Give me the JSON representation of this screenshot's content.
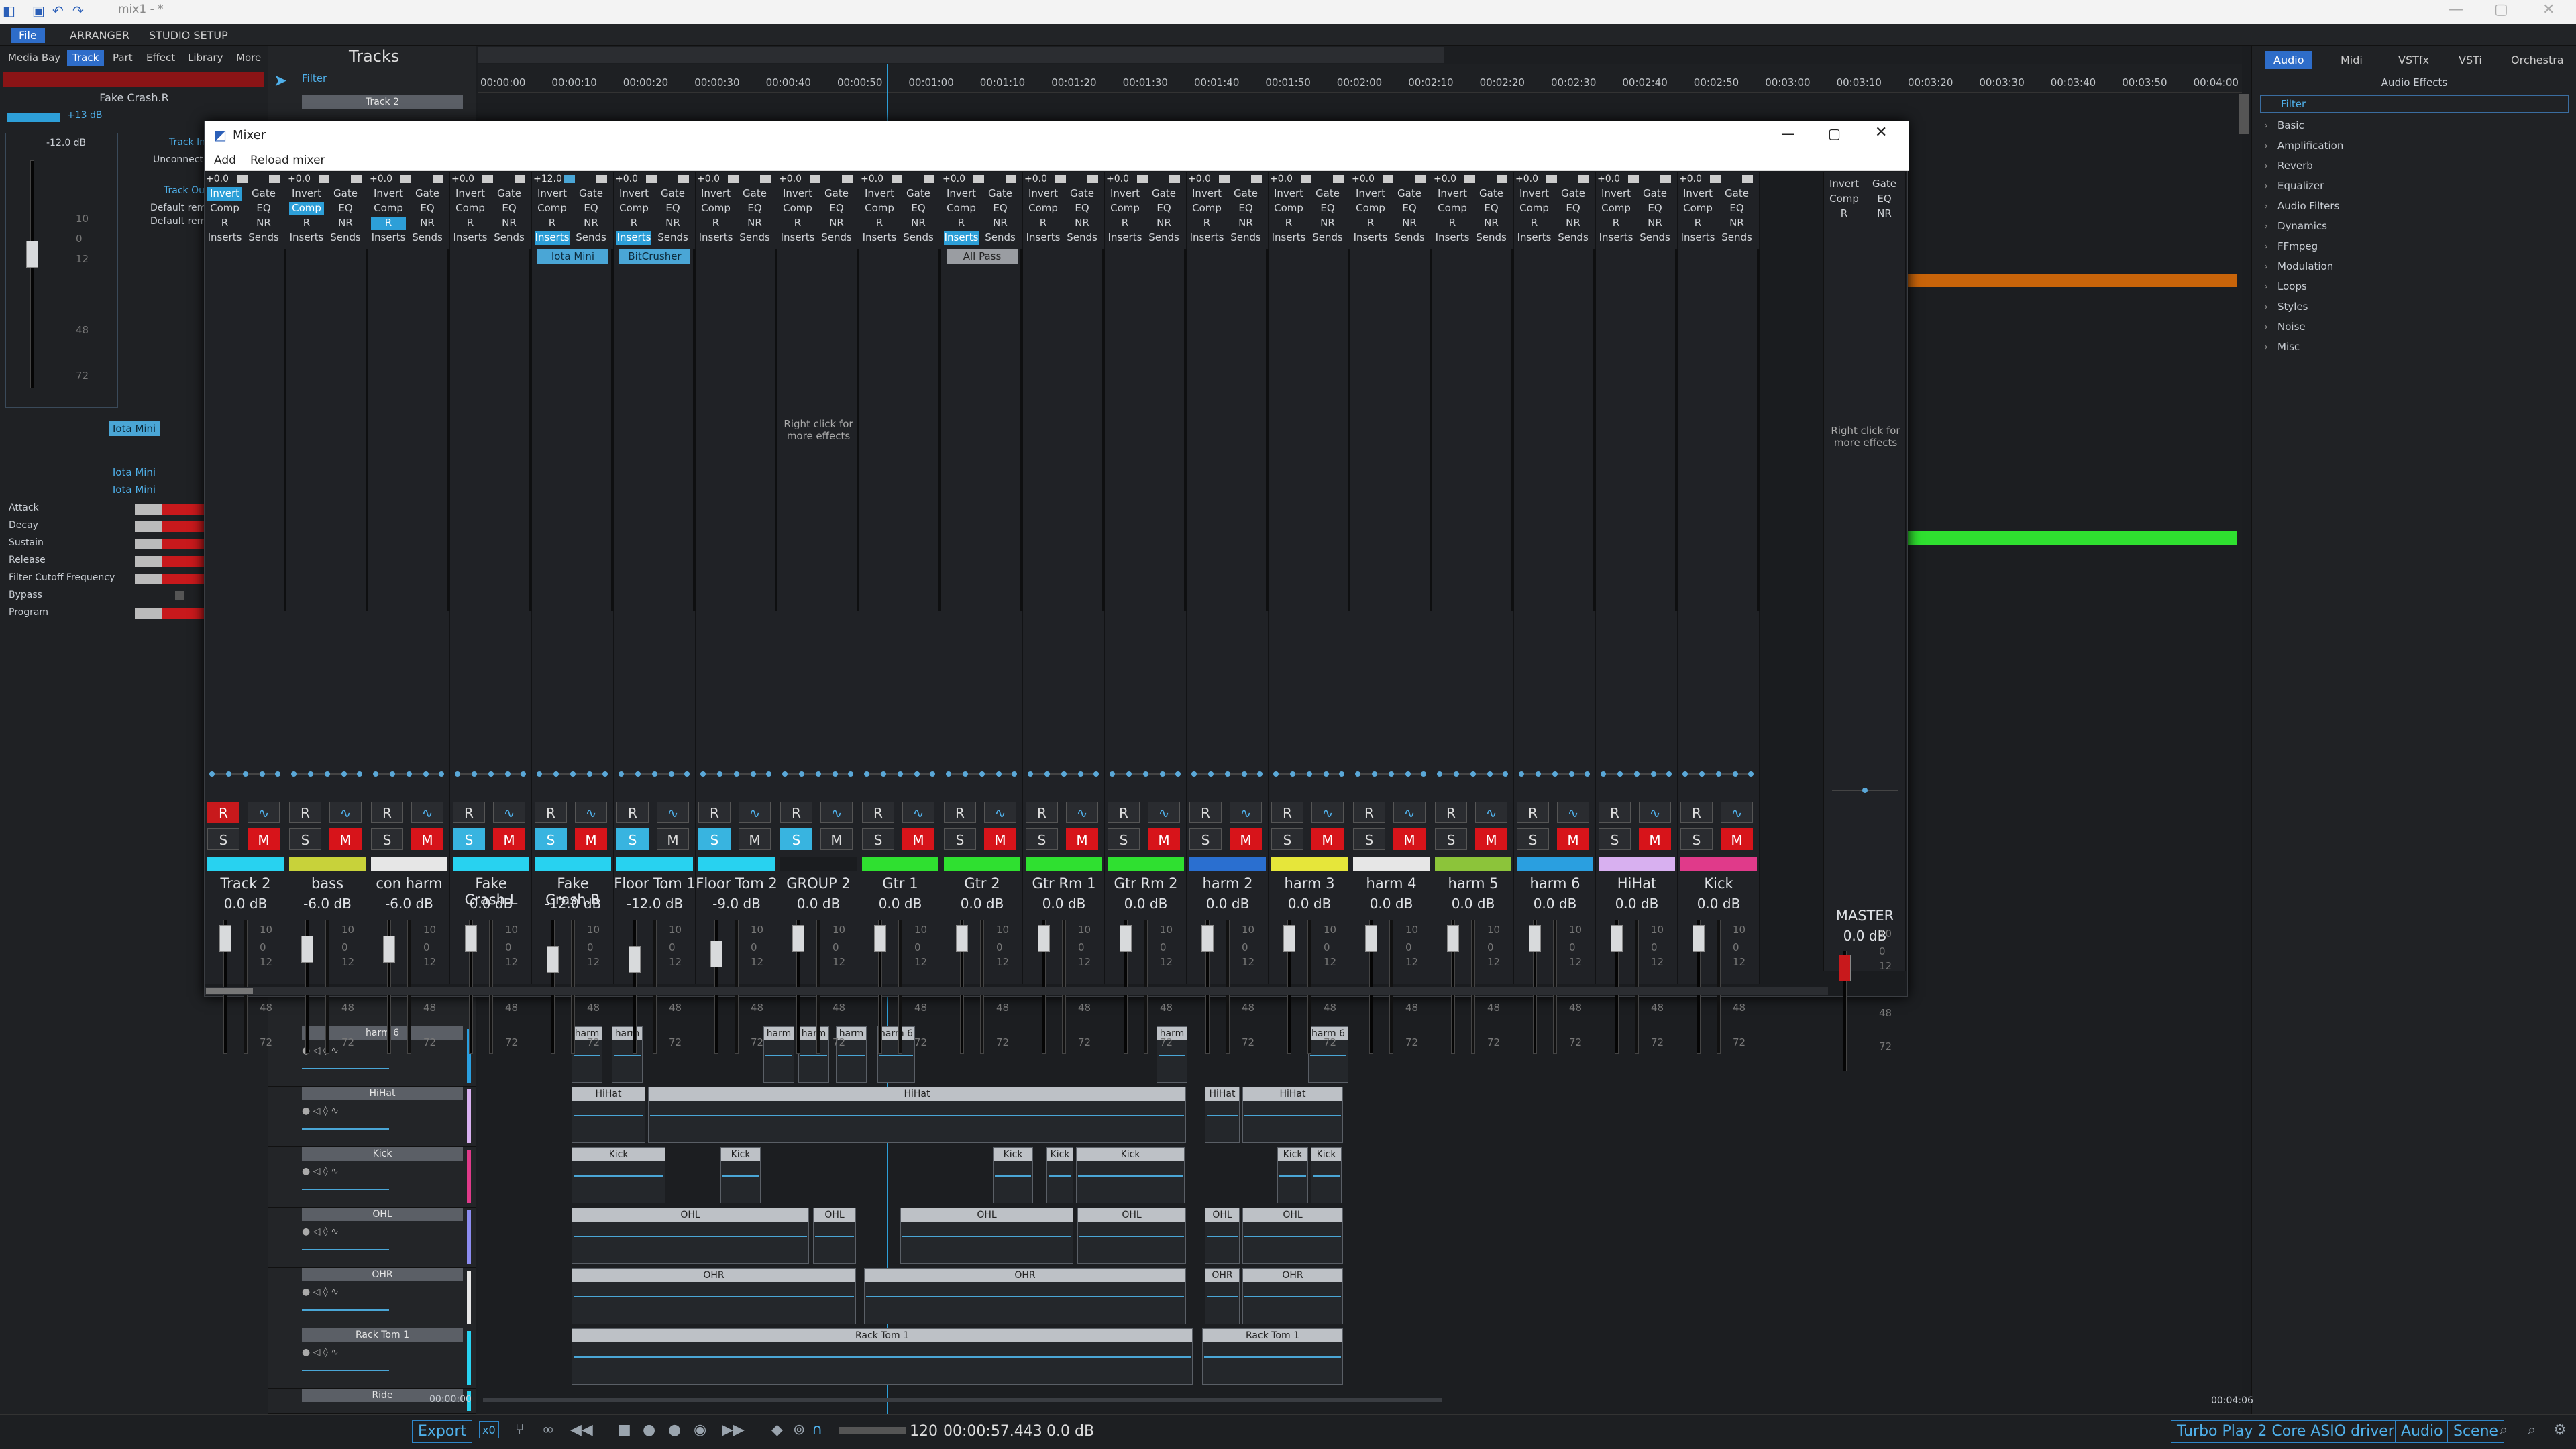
{
  "window": {
    "title": "mix1 - *"
  },
  "menu": {
    "items": [
      "File",
      "ARRANGER",
      "STUDIO SETUP"
    ],
    "active": "File"
  },
  "leftpanel": {
    "tabs": [
      "Media Bay",
      "Track",
      "Part",
      "Effect",
      "Library",
      "More"
    ],
    "active": "Track",
    "track_name": "Fake Crash.R",
    "gain": "+13 dB",
    "vol": "-12.0 dB",
    "track_in": "Track In",
    "unconnected": "Unconnect",
    "track_out": "Track Ou",
    "default1": "Default rem",
    "default2": "Default rem",
    "scale": [
      "10",
      "0",
      "12",
      "48",
      "72"
    ],
    "plugin_btn": "Iota Mini",
    "plugin_header1": "Iota Mini",
    "plugin_header2": "Iota Mini",
    "params": [
      "Attack",
      "Decay",
      "Sustain",
      "Release",
      "Filter Cutoff Frequency",
      "Bypass",
      "Program"
    ]
  },
  "tracks_header": {
    "title": "Tracks",
    "filter": "Filter",
    "first_track": "Track 2"
  },
  "ruler": {
    "ticks": [
      "00:00:00",
      "00:00:10",
      "00:00:20",
      "00:00:30",
      "00:00:40",
      "00:00:50",
      "00:01:00",
      "00:01:10",
      "00:01:20",
      "00:01:30",
      "00:01:40",
      "00:01:50",
      "00:02:00",
      "00:02:10",
      "00:02:20",
      "00:02:30",
      "00:02:40",
      "00:02:50",
      "00:03:00",
      "00:03:10",
      "00:03:20",
      "00:03:30",
      "00:03:40",
      "00:03:50",
      "00:04:00"
    ]
  },
  "rightpanel": {
    "tabs": [
      "Audio",
      "Midi",
      "VSTfx",
      "VSTi",
      "Orchestra"
    ],
    "active": "Audio",
    "section": "Audio Effects",
    "filter": "Filter",
    "categories": [
      "Basic",
      "Amplification",
      "Reverb",
      "Equalizer",
      "Audio Filters",
      "Dynamics",
      "FFmpeg",
      "Modulation",
      "Loops",
      "Styles",
      "Noise",
      "Misc"
    ]
  },
  "mixer": {
    "title": "Mixer",
    "menu": [
      "Add",
      "Reload mixer"
    ],
    "right_click_hint": "Right click for more effects",
    "labels": {
      "invert": "Invert",
      "gate": "Gate",
      "comp": "Comp",
      "eq": "EQ",
      "r": "R",
      "nr": "NR",
      "inserts": "Inserts",
      "sends": "Sends",
      "rec": "R",
      "solo": "S",
      "mute": "M"
    },
    "fader_scale": [
      "10",
      "0",
      "12",
      "48",
      "72"
    ],
    "channels": [
      {
        "name": "Track 2",
        "db": "0.0 dB",
        "color": "#28d2f0",
        "gain": "+0.0",
        "rec": true,
        "solo": false,
        "mute": true,
        "invert_on": true,
        "comp_on": false,
        "r_on": false,
        "inserts_on": false,
        "slot": ""
      },
      {
        "name": "bass",
        "db": "-6.0 dB",
        "color": "#c8d23a",
        "gain": "+0.0",
        "rec": false,
        "solo": false,
        "mute": true,
        "invert_on": false,
        "comp_on": true,
        "r_on": false,
        "inserts_on": false,
        "slot": ""
      },
      {
        "name": "con harm",
        "db": "-6.0 dB",
        "color": "#e6e6e6",
        "gain": "+0.0",
        "rec": false,
        "solo": false,
        "mute": true,
        "invert_on": false,
        "comp_on": false,
        "r_on": true,
        "inserts_on": false,
        "slot": ""
      },
      {
        "name": "Fake Crash.L",
        "db": "0.0 dB",
        "color": "#28d2f0",
        "gain": "+0.0",
        "rec": false,
        "solo": true,
        "mute": true,
        "invert_on": false,
        "comp_on": false,
        "r_on": false,
        "inserts_on": false,
        "slot": ""
      },
      {
        "name": "Fake Crash.R",
        "db": "-12.0 dB",
        "color": "#28d2f0",
        "gain": "+12.0",
        "rec": false,
        "solo": true,
        "mute": true,
        "invert_on": false,
        "comp_on": false,
        "r_on": false,
        "inserts_on": true,
        "slot": "Iota Mini"
      },
      {
        "name": "Floor Tom 1",
        "db": "-12.0 dB",
        "color": "#28d2f0",
        "gain": "+0.0",
        "rec": false,
        "solo": true,
        "mute": false,
        "invert_on": false,
        "comp_on": false,
        "r_on": false,
        "inserts_on": true,
        "slot": "BitCrusher"
      },
      {
        "name": "Floor Tom 2",
        "db": "-9.0 dB",
        "color": "#28d2f0",
        "gain": "+0.0",
        "rec": false,
        "solo": true,
        "mute": false,
        "invert_on": false,
        "comp_on": false,
        "r_on": false,
        "inserts_on": false,
        "slot": ""
      },
      {
        "name": "GROUP 2",
        "db": "0.0 dB",
        "color": "#1a1c1f",
        "gain": "+0.0",
        "rec": false,
        "solo": true,
        "mute": false,
        "invert_on": false,
        "comp_on": false,
        "r_on": false,
        "inserts_on": false,
        "slot": "",
        "hint": true
      },
      {
        "name": "Gtr 1",
        "db": "0.0 dB",
        "color": "#2fe030",
        "gain": "+0.0",
        "rec": false,
        "solo": false,
        "mute": true,
        "invert_on": false,
        "comp_on": false,
        "r_on": false,
        "inserts_on": false,
        "slot": ""
      },
      {
        "name": "Gtr 2",
        "db": "0.0 dB",
        "color": "#2fe030",
        "gain": "+0.0",
        "rec": false,
        "solo": false,
        "mute": true,
        "invert_on": false,
        "comp_on": false,
        "r_on": false,
        "inserts_on": true,
        "slot": "All Pass"
      },
      {
        "name": "Gtr Rm 1",
        "db": "0.0 dB",
        "color": "#2fe030",
        "gain": "+0.0",
        "rec": false,
        "solo": false,
        "mute": true,
        "invert_on": false,
        "comp_on": false,
        "r_on": false,
        "inserts_on": false,
        "slot": ""
      },
      {
        "name": "Gtr Rm 2",
        "db": "0.0 dB",
        "color": "#2fe030",
        "gain": "+0.0",
        "rec": false,
        "solo": false,
        "mute": true,
        "invert_on": false,
        "comp_on": false,
        "r_on": false,
        "inserts_on": false,
        "slot": ""
      },
      {
        "name": "harm 2",
        "db": "0.0 dB",
        "color": "#2a6fd0",
        "gain": "+0.0",
        "rec": false,
        "solo": false,
        "mute": true,
        "invert_on": false,
        "comp_on": false,
        "r_on": false,
        "inserts_on": false,
        "slot": ""
      },
      {
        "name": "harm 3",
        "db": "0.0 dB",
        "color": "#e6e63a",
        "gain": "+0.0",
        "rec": false,
        "solo": false,
        "mute": true,
        "invert_on": false,
        "comp_on": false,
        "r_on": false,
        "inserts_on": false,
        "slot": ""
      },
      {
        "name": "harm 4",
        "db": "0.0 dB",
        "color": "#e6e6e6",
        "gain": "+0.0",
        "rec": false,
        "solo": false,
        "mute": true,
        "invert_on": false,
        "comp_on": false,
        "r_on": false,
        "inserts_on": false,
        "slot": ""
      },
      {
        "name": "harm 5",
        "db": "0.0 dB",
        "color": "#8cc43a",
        "gain": "+0.0",
        "rec": false,
        "solo": false,
        "mute": true,
        "invert_on": false,
        "comp_on": false,
        "r_on": false,
        "inserts_on": false,
        "slot": ""
      },
      {
        "name": "harm 6",
        "db": "0.0 dB",
        "color": "#2a9fe0",
        "gain": "+0.0",
        "rec": false,
        "solo": false,
        "mute": true,
        "invert_on": false,
        "comp_on": false,
        "r_on": false,
        "inserts_on": false,
        "slot": ""
      },
      {
        "name": "HiHat",
        "db": "0.0 dB",
        "color": "#d8b0f0",
        "gain": "+0.0",
        "rec": false,
        "solo": false,
        "mute": true,
        "invert_on": false,
        "comp_on": false,
        "r_on": false,
        "inserts_on": false,
        "slot": ""
      },
      {
        "name": "Kick",
        "db": "0.0 dB",
        "color": "#e03a8a",
        "gain": "+0.0",
        "rec": false,
        "solo": false,
        "mute": true,
        "invert_on": false,
        "comp_on": false,
        "r_on": false,
        "inserts_on": false,
        "slot": ""
      }
    ],
    "master": {
      "name": "MASTER",
      "db": "0.0 dB"
    }
  },
  "tracks": [
    {
      "name": "harm 6",
      "color": "#2a9fe0",
      "clips": [
        "harm",
        "harm",
        "harm",
        "harm",
        "harm",
        "harm 6",
        "harm",
        "harm 6"
      ]
    },
    {
      "name": "HiHat",
      "color": "#d8b0f0",
      "clips": [
        "HiHat",
        "HiHat",
        "HiHat",
        "HiHat"
      ]
    },
    {
      "name": "Kick",
      "color": "#e03a8a",
      "clips": [
        "Kick",
        "Kick",
        "Kick",
        "Kick",
        "Kick",
        "Kick",
        "Kick"
      ]
    },
    {
      "name": "OHL",
      "color": "#8c8cf0",
      "clips": [
        "OHL",
        "OHL",
        "OHL",
        "OHL",
        "OHL",
        "OHL"
      ]
    },
    {
      "name": "OHR",
      "color": "#e6e6e6",
      "clips": [
        "OHR",
        "OHR",
        "OHR",
        "OHR"
      ]
    },
    {
      "name": "Rack Tom 1",
      "color": "#28d2f0",
      "clips": [
        "Rack Tom 1",
        "Rack Tom 1"
      ]
    },
    {
      "name": "Ride",
      "color": "#28d2f0",
      "clips": []
    }
  ],
  "transport": {
    "export": "Export",
    "x0": "x0",
    "tempo": "120",
    "time": "00:00:57.443",
    "level": "0.0 dB",
    "pos_start": "00:00:00",
    "pos_end": "00:04:06",
    "driver": "Turbo Play 2 Core ASIO driver",
    "audio": "Audio",
    "scene": "Scene"
  }
}
